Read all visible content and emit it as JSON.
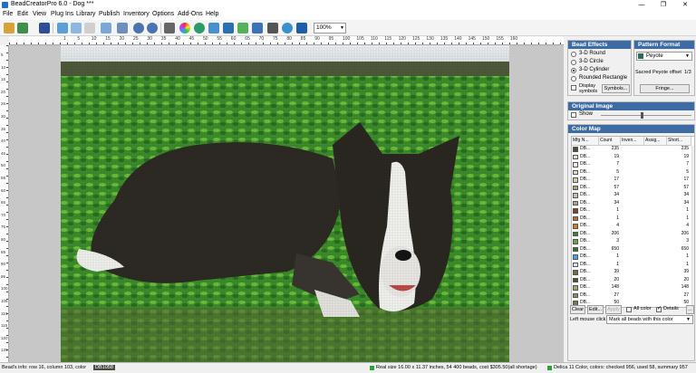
{
  "window": {
    "title": "BeadCreatorPro 6.0 - Dog ***",
    "min": "—",
    "max": "❐",
    "close": "✕"
  },
  "menu": [
    "File",
    "Edit",
    "View",
    "Plug Ins",
    "Library",
    "Publish",
    "Inventory",
    "Options",
    "Add-Ons",
    "Help"
  ],
  "toolbar": {
    "zoom": "100%"
  },
  "ruler_labels": [
    "1",
    "5",
    "10",
    "15",
    "20",
    "25",
    "30",
    "35",
    "40",
    "45",
    "50",
    "55",
    "60",
    "65",
    "70",
    "75",
    "80",
    "85",
    "90",
    "95",
    "100",
    "105",
    "110",
    "115",
    "120",
    "125",
    "130",
    "135",
    "140",
    "145",
    "150",
    "155",
    "160"
  ],
  "vruler_labels": [
    "5",
    "10",
    "15",
    "20",
    "25",
    "30",
    "35",
    "40",
    "45",
    "50",
    "55",
    "60",
    "65",
    "70",
    "75",
    "80",
    "85",
    "90",
    "95",
    "100",
    "105",
    "110",
    "115",
    "120",
    "125"
  ],
  "bead_effects": {
    "title": "Bead Effects",
    "options": [
      "3-D Round",
      "3-D Circle",
      "3-D Cylinder",
      "Rounded Rectangle"
    ],
    "selected": "3-D Cylinder",
    "display_symbols": "Display symbols",
    "symbols_button": "Symbols..."
  },
  "pattern_format": {
    "title": "Pattern Format",
    "format": "Peyote",
    "offset_label": "Sacred Peyote offset",
    "offset_value": "1/3",
    "fringe_button": "Fringe..."
  },
  "original_image": {
    "title": "Original Image",
    "show": "Show"
  },
  "color_map": {
    "title": "Color Map",
    "columns": [
      "Mfg N...",
      "Count",
      "Inven...",
      "Assig...",
      "Short..."
    ],
    "rows": [
      {
        "mfg": "DB...",
        "count": "235",
        "inv": "",
        "assig": "",
        "short": "235",
        "color": "#4a4a44"
      },
      {
        "mfg": "DB...",
        "count": "19",
        "inv": "",
        "assig": "",
        "short": "19",
        "color": "#e8e2cc"
      },
      {
        "mfg": "DB...",
        "count": "7",
        "inv": "",
        "assig": "",
        "short": "7",
        "color": "#f2efe2"
      },
      {
        "mfg": "DB...",
        "count": "5",
        "inv": "",
        "assig": "",
        "short": "5",
        "color": "#e9dcb8"
      },
      {
        "mfg": "DB...",
        "count": "17",
        "inv": "",
        "assig": "",
        "short": "17",
        "color": "#d9c9a4"
      },
      {
        "mfg": "DB...",
        "count": "57",
        "inv": "",
        "assig": "",
        "short": "57",
        "color": "#b99b72"
      },
      {
        "mfg": "DB...",
        "count": "34",
        "inv": "",
        "assig": "",
        "short": "34",
        "color": "#c7c1b2"
      },
      {
        "mfg": "DB...",
        "count": "34",
        "inv": "",
        "assig": "",
        "short": "34",
        "color": "#a8a493"
      },
      {
        "mfg": "DB...",
        "count": "1",
        "inv": "",
        "assig": "",
        "short": "1",
        "color": "#8c3c1e"
      },
      {
        "mfg": "DB...",
        "count": "1",
        "inv": "",
        "assig": "",
        "short": "1",
        "color": "#c46a28"
      },
      {
        "mfg": "DB...",
        "count": "4",
        "inv": "",
        "assig": "",
        "short": "4",
        "color": "#d87a1e"
      },
      {
        "mfg": "DB...",
        "count": "206",
        "inv": "",
        "assig": "",
        "short": "206",
        "color": "#2f8a2a"
      },
      {
        "mfg": "DB...",
        "count": "3",
        "inv": "",
        "assig": "",
        "short": "3",
        "color": "#5fae3a"
      },
      {
        "mfg": "DB...",
        "count": "650",
        "inv": "",
        "assig": "",
        "short": "650",
        "color": "#3e6e2a"
      },
      {
        "mfg": "DB...",
        "count": "1",
        "inv": "",
        "assig": "",
        "short": "1",
        "color": "#4aa1e8"
      },
      {
        "mfg": "DB...",
        "count": "1",
        "inv": "",
        "assig": "",
        "short": "1",
        "color": "#d9e8f2"
      },
      {
        "mfg": "DB...",
        "count": "39",
        "inv": "",
        "assig": "",
        "short": "39",
        "color": "#7a6a3a"
      },
      {
        "mfg": "DB...",
        "count": "20",
        "inv": "",
        "assig": "",
        "short": "20",
        "color": "#5a4a2a"
      },
      {
        "mfg": "DB...",
        "count": "148",
        "inv": "",
        "assig": "",
        "short": "148",
        "color": "#9aa870"
      },
      {
        "mfg": "DB...",
        "count": "27",
        "inv": "",
        "assig": "",
        "short": "27",
        "color": "#8e8a6a"
      },
      {
        "mfg": "DB...",
        "count": "50",
        "inv": "",
        "assig": "",
        "short": "50",
        "color": "#6e7a4a"
      }
    ],
    "buttons": {
      "clear": "Clear",
      "edit": "Edit...",
      "apply": "Apply",
      "all_color": "All color",
      "details": "Details",
      "more": "..."
    },
    "left_click_label": "Left mouse click",
    "left_click_value": "Mark all beads with this color"
  },
  "status": {
    "bead_info": "Bead's info: row 16, column 103, color",
    "color_code": "DB1058",
    "real_size": "Real size 16.00 x 11.37 inches, 54 400 beads, cost $305.50(all shortage)",
    "summary": "Delica 11 Color, colors: checked 956, used 58, summary 957"
  }
}
